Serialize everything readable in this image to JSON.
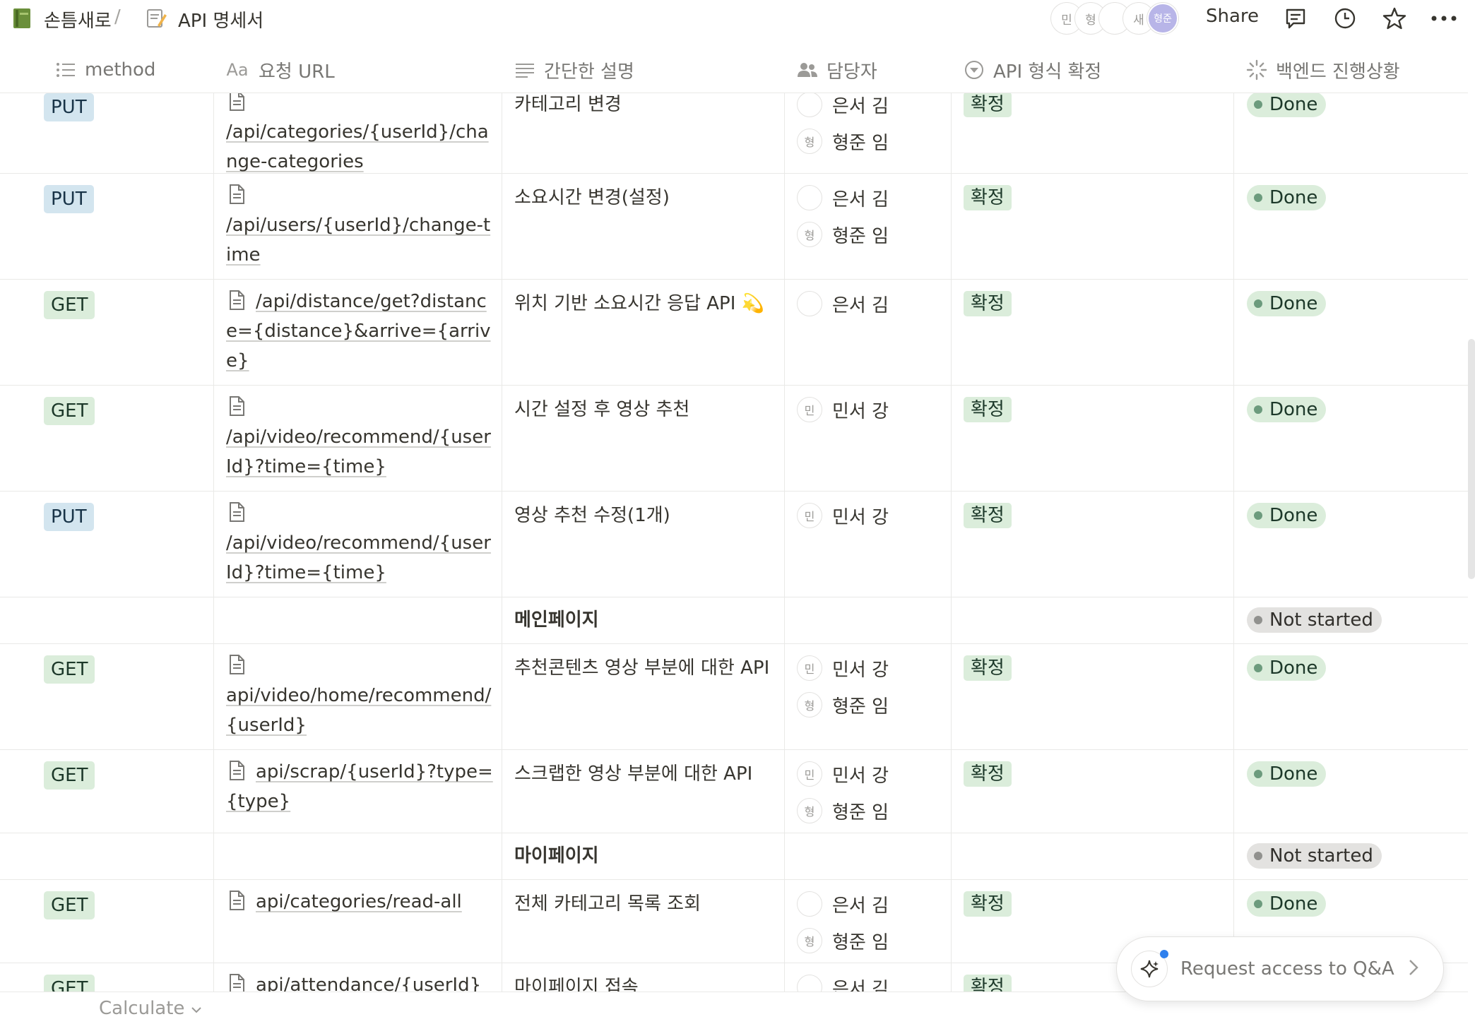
{
  "topbar": {
    "breadcrumb_1_icon": "book-icon",
    "breadcrumb_1": "손틈새로",
    "separator": "/",
    "breadcrumb_2_icon": "memo-icon",
    "breadcrumb_2": "API 명세서",
    "avatars": [
      "민",
      "형",
      "",
      "새",
      "형준"
    ],
    "share": "Share"
  },
  "columns": {
    "method": "method",
    "url": "요청 URL",
    "desc": "간단한 설명",
    "owner": "담당자",
    "format": "API 형식 확정",
    "backend": "백엔드 진행상황"
  },
  "rows": [
    {
      "method": "PUT",
      "url": "/api/categories/{userId}/change-categories",
      "desc": "카테고리 변경",
      "people": [
        {
          "initial": "",
          "name": "은서 김"
        },
        {
          "initial": "형",
          "name": "형준 임"
        }
      ],
      "format": "확정",
      "status": "Done"
    },
    {
      "method": "PUT",
      "url": "/api/users/{userId}/change-time",
      "desc": "소요시간 변경(설정)",
      "people": [
        {
          "initial": "",
          "name": "은서 김"
        },
        {
          "initial": "형",
          "name": "형준 임"
        }
      ],
      "format": "확정",
      "status": "Done"
    },
    {
      "method": "GET",
      "url": "/api/distance/get?distance={distance}&arrive={arrive}",
      "desc": "위치 기반 소요시간 응답 API 💫",
      "people": [
        {
          "initial": "",
          "name": "은서 김"
        }
      ],
      "format": "확정",
      "status": "Done"
    },
    {
      "method": "GET",
      "url": "/api/video/recommend/{userId}?time={time}",
      "desc": "시간 설정 후 영상 추천",
      "people": [
        {
          "initial": "민",
          "name": "민서 강"
        }
      ],
      "format": "확정",
      "status": "Done"
    },
    {
      "method": "PUT",
      "url": "/api/video/recommend/{userId}?time={time}",
      "desc": "영상 추천 수정(1개)",
      "people": [
        {
          "initial": "민",
          "name": "민서 강"
        }
      ],
      "format": "확정",
      "status": "Done"
    },
    {
      "method": "",
      "url": "",
      "desc": "메인페이지",
      "people": [],
      "format": "",
      "status": "Not started"
    },
    {
      "method": "GET",
      "url": "api/video/home/recommend/{userId}",
      "desc": "추천콘텐츠 영상 부분에 대한 API",
      "people": [
        {
          "initial": "민",
          "name": "민서 강"
        },
        {
          "initial": "형",
          "name": "형준 임"
        }
      ],
      "format": "확정",
      "status": "Done"
    },
    {
      "method": "GET",
      "url": "api/scrap/{userId}?type={type}",
      "desc": "스크랩한 영상 부분에 대한 API",
      "people": [
        {
          "initial": "민",
          "name": "민서 강"
        },
        {
          "initial": "형",
          "name": "형준 임"
        }
      ],
      "format": "확정",
      "status": "Done"
    },
    {
      "method": "",
      "url": "",
      "desc": "마이페이지",
      "people": [],
      "format": "",
      "status": "Not started"
    },
    {
      "method": "GET",
      "url": "api/categories/read-all",
      "desc": "전체 카테고리 목록 조회",
      "people": [
        {
          "initial": "",
          "name": "은서 김"
        },
        {
          "initial": "형",
          "name": "형준 임"
        }
      ],
      "format": "확정",
      "status": "Done"
    },
    {
      "method": "GET",
      "url": "api/attendance/{userId}",
      "desc": "마이페이지 접속",
      "people": [
        {
          "initial": "",
          "name": "은서 김"
        }
      ],
      "format": "확정",
      "status": ""
    }
  ],
  "footer": {
    "calculate": "Calculate",
    "qa_label": "Request access to Q&A"
  },
  "colors": {
    "get_bg": "#dbeddb",
    "put_bg": "#d3e5ef",
    "done_bg": "#dbeddb",
    "not_started_bg": "#e3e2e0"
  }
}
